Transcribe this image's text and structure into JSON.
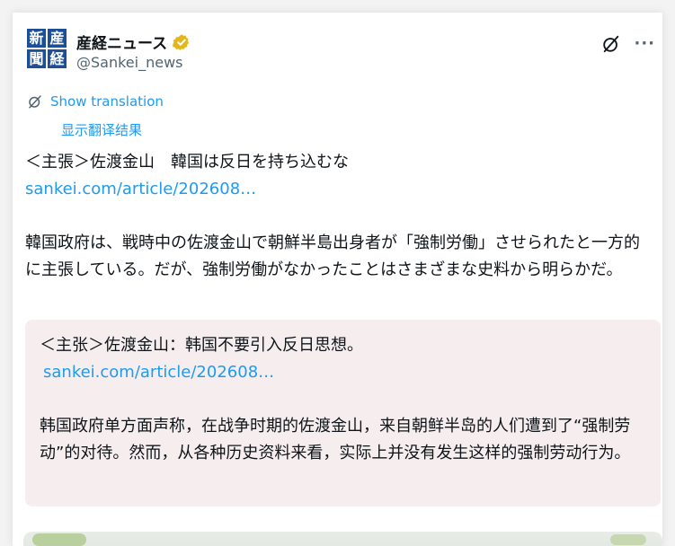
{
  "tweet": {
    "author": {
      "display_name": "産経ニュース",
      "handle": "@Sankei_news",
      "avatar_chars": [
        "新",
        "産",
        "聞",
        "経"
      ]
    },
    "translate": {
      "show_translation": "Show translation",
      "zh_label": "显示翻译结果"
    },
    "headline": "＜主張＞佐渡金山　韓国は反日を持ち込むな",
    "link": "sankei.com/article/202608…",
    "paragraph": "韓国政府は、戦時中の佐渡金山で朝鮮半島出身者が「強制労働」させられたと一方的に主張している。だが、強制労働がなかったことはさまざまな史料から明らかだ。",
    "translation_box": {
      "headline": "＜主张＞佐渡金山：韩国不要引入反日思想。",
      "link": "sankei.com/article/202608…",
      "paragraph": "韩国政府单方面声称，在战争时期的佐渡金山，来自朝鲜半岛的人们遭到了“强制劳动”的对待。然而，从各种历史资料来看，实际上并没有发生这样的强制劳动行为。"
    }
  },
  "icons": {
    "verified": "verified-badge-icon",
    "grok": "grok-icon",
    "more": "more-options-icon",
    "translate": "translate-icon"
  },
  "colors": {
    "link": "#1d9bf0",
    "verified_gold": "#e2b719",
    "avatar_blue": "#1d4f98",
    "quote_bg": "#f6eeee"
  }
}
